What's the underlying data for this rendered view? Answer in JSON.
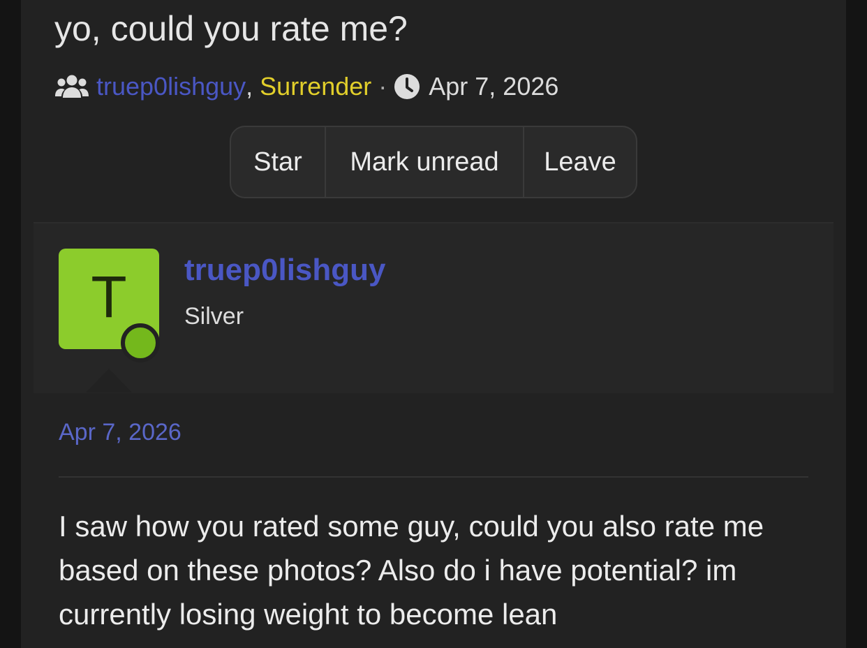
{
  "thread": {
    "title": "yo, could you rate me?",
    "participant_1": "truep0lishguy",
    "participant_separator": ",",
    "participant_2": "Surrender",
    "meta_separator": "·",
    "date": "Apr 7, 2026"
  },
  "actions": {
    "star": "Star",
    "mark_unread": "Mark unread",
    "leave": "Leave"
  },
  "post": {
    "avatar_letter": "T",
    "author": "truep0lishguy",
    "author_title": "Silver",
    "date": "Apr 7, 2026",
    "body": "I saw how you rated some guy, could you also rate me based on these photos? Also do i have potential? im currently losing weight to become lean"
  },
  "colors": {
    "link_blue": "#4a57c4",
    "user_yellow": "#e2cf2b",
    "avatar_green": "#8ccc2c",
    "online_green": "#74b81c"
  },
  "icons": {
    "participants": "users-icon",
    "date": "clock-icon"
  }
}
